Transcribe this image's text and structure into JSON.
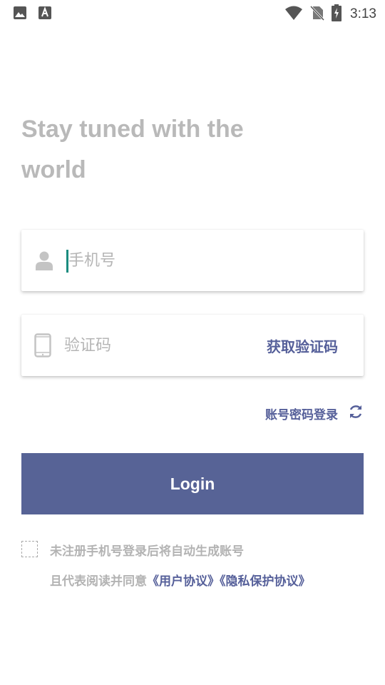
{
  "status_bar": {
    "time": "3:13",
    "left_icons": [
      "image-icon",
      "text-a-icon"
    ],
    "right_icons": [
      "wifi-icon",
      "no-sim-icon",
      "battery-charging-icon"
    ]
  },
  "headline": "Stay tuned with the world",
  "phone_field": {
    "placeholder": "手机号",
    "value": "",
    "icon": "user-icon"
  },
  "code_field": {
    "placeholder": "验证码",
    "value": "",
    "icon": "phone-device-icon"
  },
  "get_code_label": "获取验证码",
  "switch_login": {
    "label": "账号密码登录",
    "icon": "refresh-icon"
  },
  "login_label": "Login",
  "agreement": {
    "checked": false,
    "line1": "未注册手机号登录后将自动生成账号",
    "line2_prefix": "且代表阅读并同意",
    "user_agreement": "《用户协议》",
    "privacy_policy": "《隐私保护协议》"
  },
  "colors": {
    "accent": "#576396",
    "link": "#56609a",
    "headline": "#b9b9b9",
    "placeholder": "#b5b5b5",
    "caret": "#1a8c7f"
  }
}
